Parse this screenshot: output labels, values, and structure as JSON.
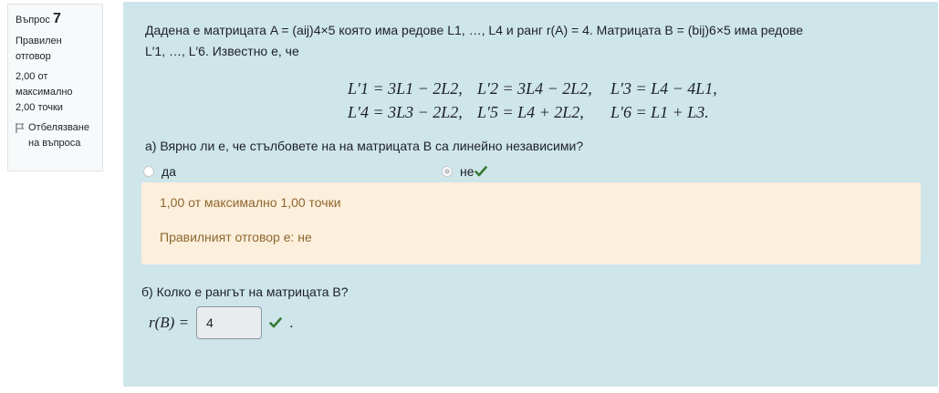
{
  "info": {
    "question_label": "Въпрос",
    "question_number": "7",
    "state": "Правилен отговор",
    "grade": "2,00 от максимално 2,00 точки",
    "flag_label": "Отбелязване на въпроса"
  },
  "question": {
    "intro_1": "Дадена е матрицата A = (aij)4×5 която има редове L1, …, L4 и ранг r(A) = 4. Матрицата B = (bij)6×5 има редове",
    "intro_2": "L′1, …, L′6. Известно е, че",
    "equations": [
      "L′1 = 3L1 − 2L2,",
      "L′2 = 3L4 − 2L2,",
      "L′3 = L4 − 4L1,",
      "L′4 = 3L3 − 2L2,",
      "L′5 = L4 + 2L2,",
      "L′6 = L1 + L3."
    ],
    "part_a": "а) Вярно ли е, че  стълбовете на  на матрицата B са линейно независими?",
    "options": [
      "да",
      "не"
    ],
    "selected_option": "не",
    "feedback_grade": "1,00 от максимално 1,00 точки",
    "feedback_correct": "Правилният отговор е:   не",
    "part_b": "б) Колко е рангът   на матрицата B?",
    "rank_label": "r(B) =",
    "rank_value": "4",
    "rank_suffix": "."
  },
  "colors": {
    "content_bg": "#cee5ea",
    "feedback_bg": "#fcefdc",
    "feedback_text": "#8e662e",
    "correct_green": "#357a32"
  }
}
